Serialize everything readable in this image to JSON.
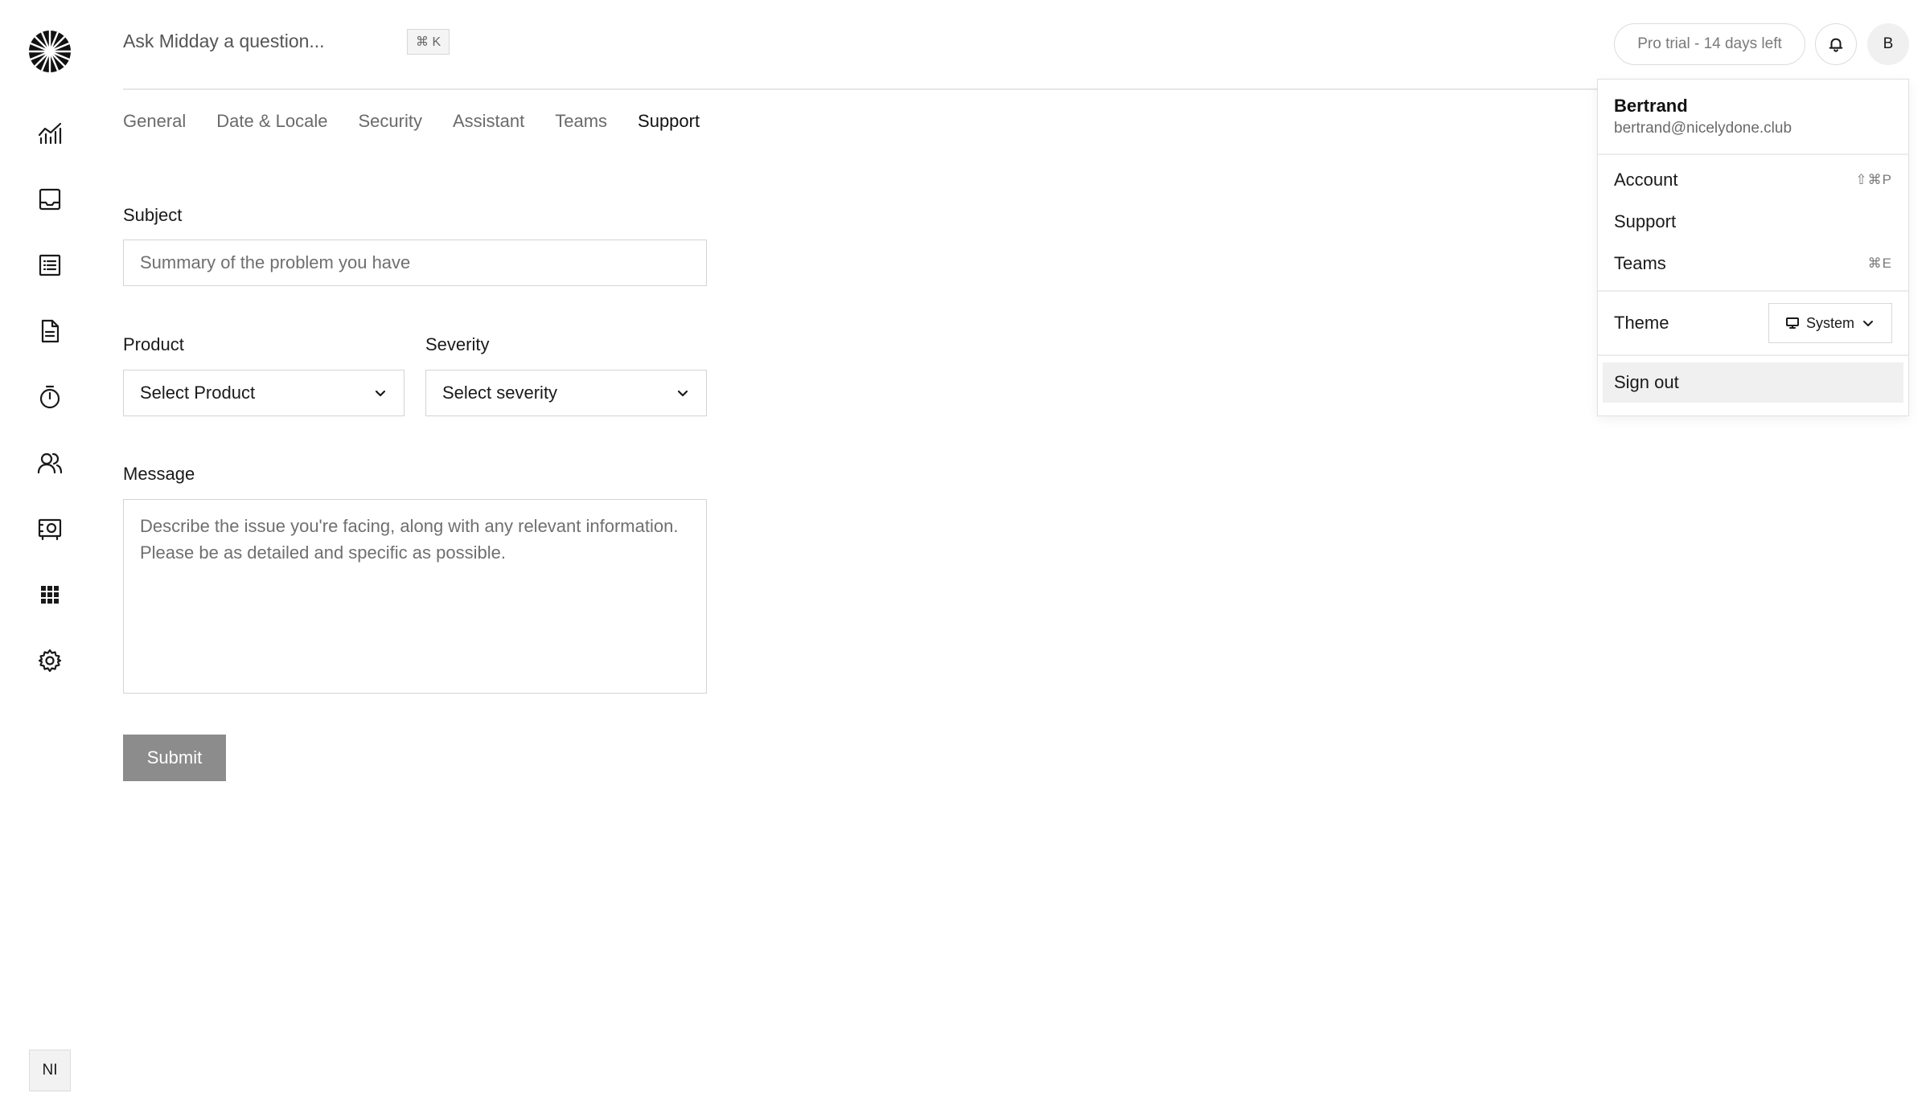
{
  "header": {
    "ask_placeholder": "Ask Midday a question...",
    "shortcut": "⌘ K",
    "trial_label": "Pro trial - 14 days left",
    "avatar_initial": "B"
  },
  "sidebar": {
    "items": [
      {
        "icon": "chart-icon"
      },
      {
        "icon": "inbox-icon"
      },
      {
        "icon": "transactions-icon"
      },
      {
        "icon": "invoice-icon"
      },
      {
        "icon": "timer-icon"
      },
      {
        "icon": "customers-icon"
      },
      {
        "icon": "vault-icon"
      },
      {
        "icon": "apps-icon"
      },
      {
        "icon": "settings-icon"
      }
    ],
    "team_initials": "NI"
  },
  "tabs": [
    "General",
    "Date & Locale",
    "Security",
    "Assistant",
    "Teams",
    "Support"
  ],
  "active_tab": "Support",
  "form": {
    "subject_label": "Subject",
    "subject_placeholder": "Summary of the problem you have",
    "product_label": "Product",
    "product_value": "Select Product",
    "severity_label": "Severity",
    "severity_value": "Select severity",
    "message_label": "Message",
    "message_placeholder": "Describe the issue you're facing, along with any relevant information. Please be as detailed and specific as possible.",
    "submit_label": "Submit"
  },
  "user_menu": {
    "name": "Bertrand",
    "email": "bertrand@nicelydone.club",
    "items": [
      {
        "label": "Account",
        "shortcut": "⇧⌘P"
      },
      {
        "label": "Support",
        "shortcut": ""
      },
      {
        "label": "Teams",
        "shortcut": "⌘E"
      }
    ],
    "theme_label": "Theme",
    "theme_value": "System",
    "sign_out_label": "Sign out"
  }
}
